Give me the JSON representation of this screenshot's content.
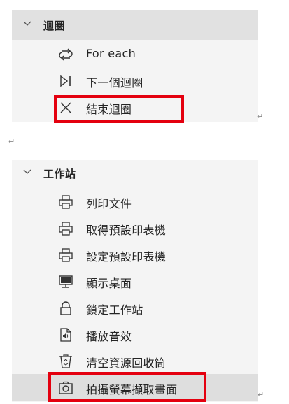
{
  "loops": {
    "title": "迴圈",
    "items": [
      {
        "label": "For each",
        "icon": "loop-arrows-icon"
      },
      {
        "label": "下一個迴圈",
        "icon": "next-loop-icon"
      },
      {
        "label": "結束迴圈",
        "icon": "close-x-icon"
      }
    ]
  },
  "workstation": {
    "title": "工作站",
    "items": [
      {
        "label": "列印文件",
        "icon": "printer-icon"
      },
      {
        "label": "取得預設印表機",
        "icon": "printer-icon"
      },
      {
        "label": "設定預設印表機",
        "icon": "printer-icon"
      },
      {
        "label": "顯示桌面",
        "icon": "monitor-icon"
      },
      {
        "label": "鎖定工作站",
        "icon": "lock-icon"
      },
      {
        "label": "播放音效",
        "icon": "audio-file-icon"
      },
      {
        "label": "清空資源回收筒",
        "icon": "recycle-bin-icon"
      },
      {
        "label": "拍攝螢幕擷取畫面",
        "icon": "camera-icon"
      }
    ]
  },
  "colors": {
    "highlight": "#e4000f",
    "panel_bg": "#f4f4f4",
    "header_bg": "#e1e1e1",
    "selected_bg": "#dedede"
  },
  "return_mark": "↵"
}
